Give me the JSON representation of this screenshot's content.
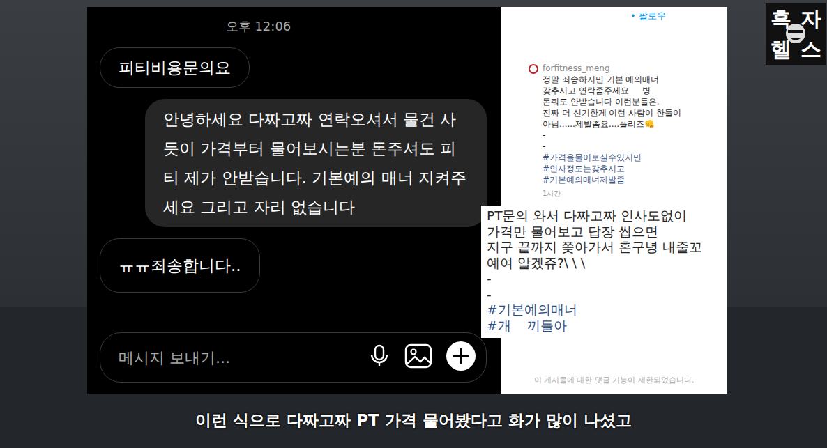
{
  "dm": {
    "time": "오후 12:06",
    "messages": [
      {
        "text": "피티비용문의요",
        "kind": "received"
      },
      {
        "text": "안녕하세요 다짜고짜 연락오셔서 물건 사듯이 가격부터 물어보시는분 돈주셔도 피티 제가 안받습니다. 기본예의 매너 지켜주세요 그리고 자리 없습니다",
        "kind": "sent"
      },
      {
        "text": "ㅠㅠ죄송합니다..",
        "kind": "received"
      }
    ],
    "input": {
      "placeholder": "메시지 보내기..."
    }
  },
  "post": {
    "follow": "• 팔로우",
    "username": "forfitness_meng",
    "caption": [
      "정말 죄송하지만 기본 예의매너",
      "갖추시고 연락좀주세요     병",
      "돈줘도 안받습니다 이런분들은.",
      "진짜 더 신기한게 이런 사람이 한둘이",
      "아님......제발좀요....플리즈👊",
      "-",
      "-"
    ],
    "hashtags": [
      "#가격을물어보실수있지만",
      "#인사정도는갖추시고",
      "#기본예의매너제발좀"
    ],
    "time": "1시간",
    "notice": "이 게시물에 대한 댓글 기능이 제한되었습니다."
  },
  "overlay": {
    "lines": [
      "PT문의 와서 다짜고짜 인사도없이",
      "가격만 물어보고 답장 씹으면",
      "지구 끝까지 쫒아가서 혼구녕 내줄꼬",
      "예여 알겠쥬?\\ \\ \\",
      "-",
      "-"
    ],
    "hashtags": [
      "#기본예의매너",
      "#개    끼들아"
    ]
  },
  "logo": [
    "흑",
    "자",
    "헬",
    "스"
  ],
  "subtitle": "이런 식으로 다짜고짜 PT 가격 물어봤다고 화가 많이 나셨고"
}
